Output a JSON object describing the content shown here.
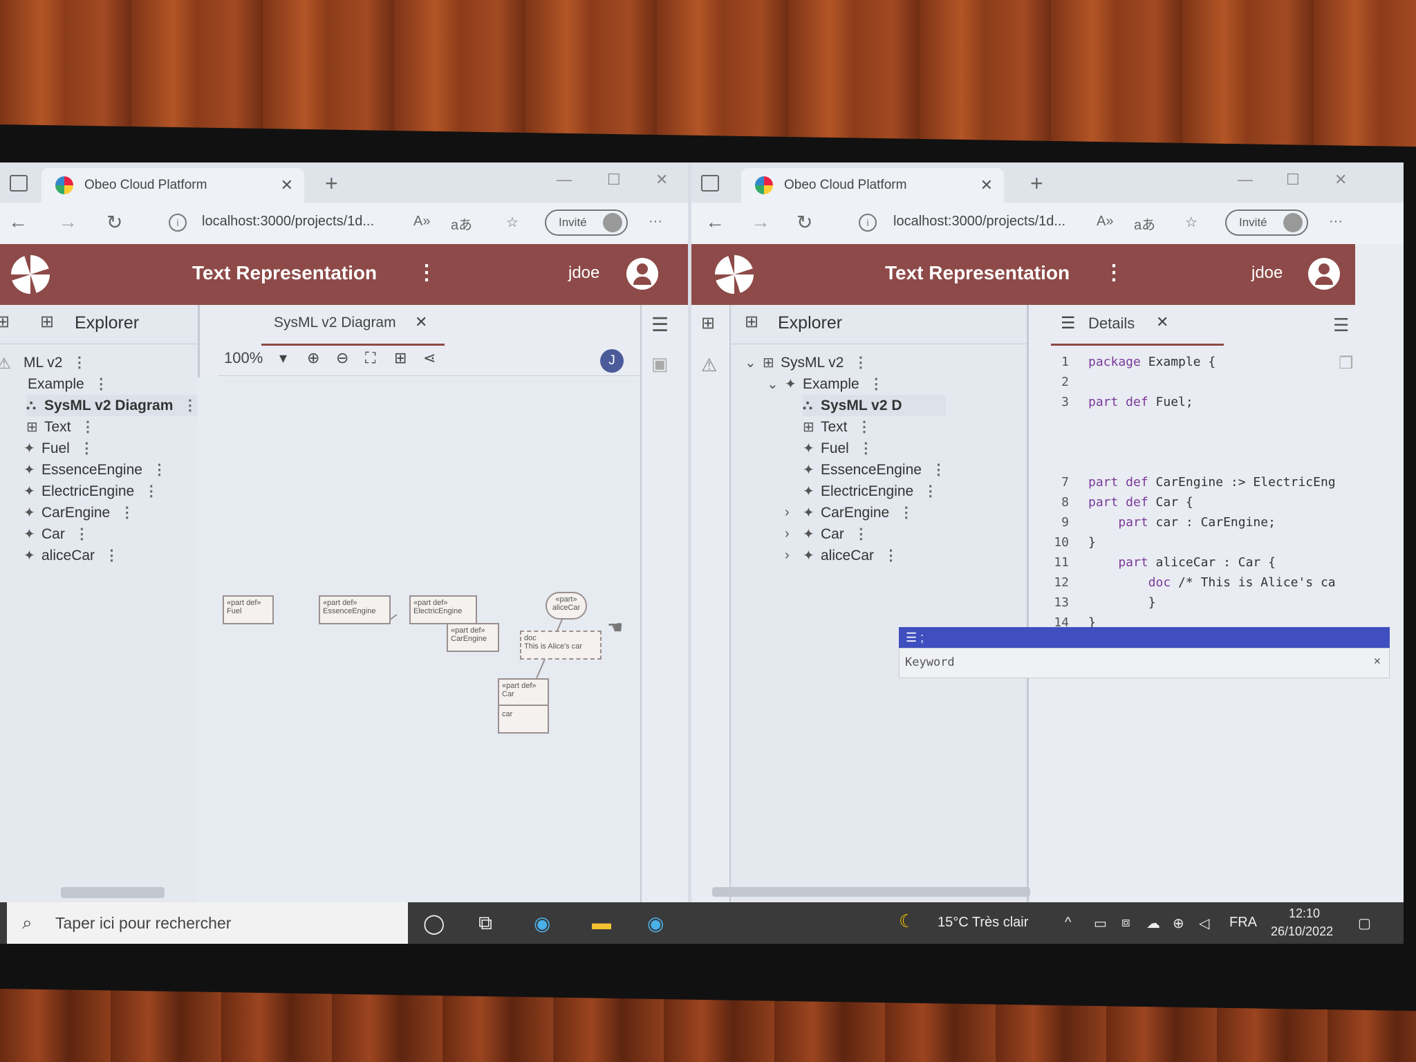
{
  "browser": {
    "tab_title": "Obeo Cloud Platform",
    "url": "localhost:3000/projects/1d...",
    "profile_label": "Invité",
    "more": "···"
  },
  "app": {
    "title": "Text Representation",
    "user": "jdoe"
  },
  "left": {
    "explorer_label": "Explorer",
    "diagram_tab": "SysML v2 Diagram",
    "zoom": "100%",
    "user_initial": "J",
    "tree": [
      {
        "label": "ML v2"
      },
      {
        "label": "Example"
      },
      {
        "label": "SysML v2 Diagram"
      },
      {
        "label": "Text"
      },
      {
        "label": "Fuel"
      },
      {
        "label": "EssenceEngine"
      },
      {
        "label": "ElectricEngine"
      },
      {
        "label": "CarEngine"
      },
      {
        "label": "Car"
      },
      {
        "label": "aliceCar"
      }
    ],
    "diagram_nodes": [
      {
        "stereo": "«part def»",
        "name": "Fuel"
      },
      {
        "stereo": "«part def»",
        "name": "EssenceEngine"
      },
      {
        "stereo": "«part def»",
        "name": "ElectricEngine"
      },
      {
        "stereo": "«part»",
        "name": "aliceCar"
      },
      {
        "stereo": "«part def»",
        "name": "CarEngine"
      },
      {
        "stereo": "doc",
        "name": "This is Alice's car"
      },
      {
        "stereo": "«part def»",
        "name": "Car",
        "compartment": "car"
      }
    ]
  },
  "right": {
    "explorer_label": "Explorer",
    "details_tab": "Details",
    "tree": [
      {
        "label": "SysML v2"
      },
      {
        "label": "Example"
      },
      {
        "label": "SysML v2 D"
      },
      {
        "label": "Text"
      },
      {
        "label": "Fuel"
      },
      {
        "label": "EssenceEngine"
      },
      {
        "label": "ElectricEngine"
      },
      {
        "label": "CarEngine"
      },
      {
        "label": "Car"
      },
      {
        "label": "aliceCar"
      }
    ],
    "autocomplete": {
      "selected": ";",
      "option": "Keyword"
    },
    "code_lines": [
      {
        "n": "1",
        "a": "package ",
        "b": "Example {"
      },
      {
        "n": "2",
        "a": "",
        "b": ""
      },
      {
        "n": "3",
        "a": "part def ",
        "b": "Fuel;"
      },
      {
        "n": "7",
        "a": "part def ",
        "b": "CarEngine :> ElectricEng"
      },
      {
        "n": "8",
        "a": "part def ",
        "b": "Car {"
      },
      {
        "n": "9",
        "a": "    part ",
        "b": "car : CarEngine;"
      },
      {
        "n": "10",
        "a": "",
        "b": "}"
      },
      {
        "n": "11",
        "a": "    part ",
        "b": "aliceCar : Car {"
      },
      {
        "n": "12",
        "a": "        doc ",
        "b": "/* This is Alice's ca"
      },
      {
        "n": "13",
        "a": "",
        "b": "        }"
      },
      {
        "n": "14",
        "a": "",
        "b": "}"
      },
      {
        "n": "15",
        "a": "",
        "b": ""
      }
    ]
  },
  "taskbar": {
    "search_placeholder": "Taper ici pour rechercher",
    "weather": "15°C  Très clair",
    "lang": "FRA",
    "time": "12:10",
    "date": "26/10/2022"
  }
}
